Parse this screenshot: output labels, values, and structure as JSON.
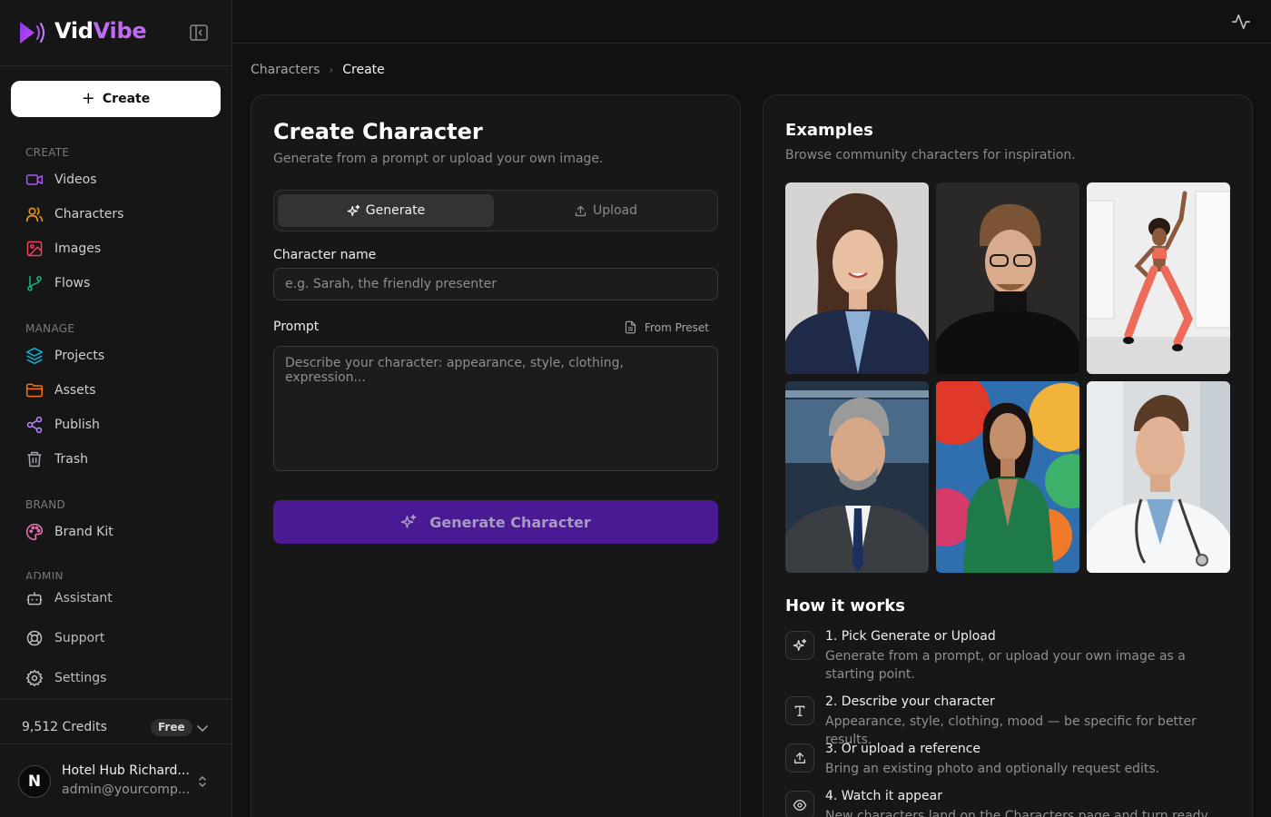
{
  "app": {
    "name_part1": "Vid",
    "name_part2": "Vibe",
    "accent_color": "#c06af5"
  },
  "sidebar": {
    "create_label": "Create",
    "sections": {
      "create": "CREATE",
      "manage": "MANAGE",
      "brand": "BRAND",
      "admin": "ADMIN"
    },
    "items": [
      {
        "label": "Videos",
        "icon": "video-icon",
        "color": "#a855f7"
      },
      {
        "label": "Characters",
        "icon": "users-icon",
        "color": "#f59e0b"
      },
      {
        "label": "Images",
        "icon": "image-icon",
        "color": "#f43f5e"
      },
      {
        "label": "Flows",
        "icon": "git-branch-icon",
        "color": "#10b981"
      },
      {
        "label": "Projects",
        "icon": "layers-icon",
        "color": "#06b6d4"
      },
      {
        "label": "Assets",
        "icon": "folder-icon",
        "color": "#f97316"
      },
      {
        "label": "Publish",
        "icon": "share-icon",
        "color": "#c084fc"
      },
      {
        "label": "Trash",
        "icon": "trash-icon",
        "color": "#9ca3af"
      },
      {
        "label": "Brand Kit",
        "icon": "palette-icon",
        "color": "#f472b6"
      }
    ],
    "bottom_items": [
      {
        "label": "Assistant",
        "icon": "bot-icon"
      },
      {
        "label": "Support",
        "icon": "lifebuoy-icon"
      },
      {
        "label": "Settings",
        "icon": "gear-icon"
      }
    ],
    "credits": "9,512 Credits",
    "plan_badge": "Free",
    "user": {
      "initial": "N",
      "name": "Hotel Hub Richard...",
      "email": "admin@yourcomp..."
    }
  },
  "breadcrumb": {
    "parent": "Characters",
    "separator": "›",
    "current": "Create"
  },
  "form": {
    "title": "Create Character",
    "subtitle": "Generate from a prompt or upload your own image.",
    "tab_generate": "Generate",
    "tab_upload": "Upload",
    "name_label": "Character name",
    "name_placeholder": "e.g. Sarah, the friendly presenter",
    "prompt_label": "Prompt",
    "preset_label": "From Preset",
    "prompt_placeholder": "Describe your character: appearance, style, clothing, expression...",
    "submit_label": "Generate Character"
  },
  "examples": {
    "title": "Examples",
    "subtitle": "Browse community characters for inspiration.",
    "thumbnails": [
      {
        "name": "woman-navy-blazer-portrait"
      },
      {
        "name": "man-glasses-turtleneck-portrait"
      },
      {
        "name": "woman-fitness-jumping"
      },
      {
        "name": "man-suit-news-studio"
      },
      {
        "name": "woman-green-blazer-painted"
      },
      {
        "name": "doctor-stethoscope-portrait"
      }
    ]
  },
  "how_it_works": {
    "title": "How it works",
    "steps": [
      {
        "title": "1. Pick Generate or Upload",
        "desc": "Generate from a prompt, or upload your own image as a starting point.",
        "icon": "sparkles-icon"
      },
      {
        "title": "2. Describe your character",
        "desc": "Appearance, style, clothing, mood — be specific for better results.",
        "icon": "type-icon"
      },
      {
        "title": "3. Or upload a reference",
        "desc": "Bring an existing photo and optionally request edits.",
        "icon": "upload-icon"
      },
      {
        "title": "4. Watch it appear",
        "desc": "New characters land on the Characters page and turn ready in...",
        "icon": "eye-icon"
      }
    ]
  }
}
